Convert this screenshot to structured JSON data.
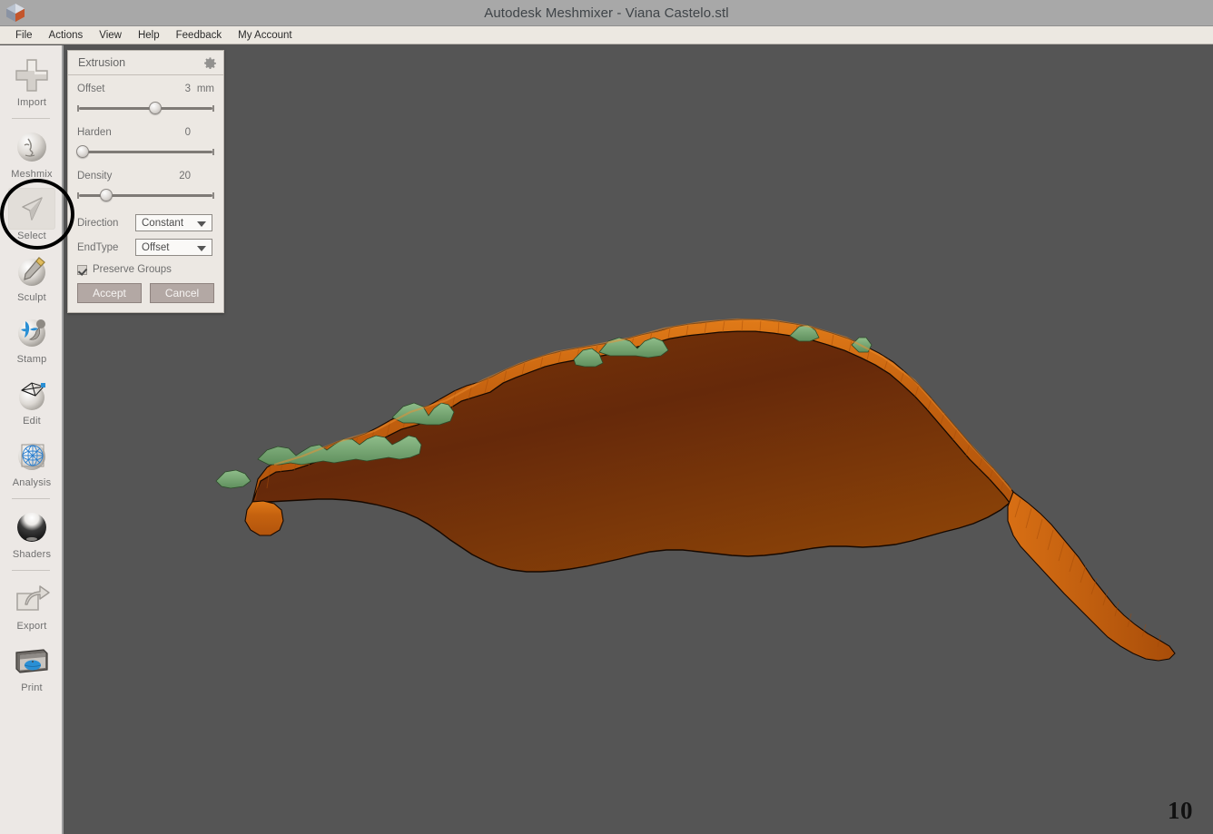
{
  "window": {
    "title": "Autodesk Meshmixer - Viana Castelo.stl",
    "logo_icon": "meshmixer-cube-logo"
  },
  "menubar": {
    "items": [
      {
        "label": "File",
        "name": "menu-file"
      },
      {
        "label": "Actions",
        "name": "menu-actions"
      },
      {
        "label": "View",
        "name": "menu-view"
      },
      {
        "label": "Help",
        "name": "menu-help"
      },
      {
        "label": "Feedback",
        "name": "menu-feedback"
      },
      {
        "label": "My Account",
        "name": "menu-my-account"
      }
    ]
  },
  "sidebar": {
    "items": [
      {
        "label": "Import",
        "icon": "plus-icon",
        "selected": false,
        "separator_after": true
      },
      {
        "label": "Meshmix",
        "icon": "face-sphere-icon",
        "selected": false,
        "separator_after": false
      },
      {
        "label": "Select",
        "icon": "cursor-arrow-icon",
        "selected": true,
        "separator_after": false
      },
      {
        "label": "Sculpt",
        "icon": "brush-sphere-icon",
        "selected": false,
        "separator_after": false
      },
      {
        "label": "Stamp",
        "icon": "stamp-sphere-icon",
        "selected": false,
        "separator_after": false
      },
      {
        "label": "Edit",
        "icon": "mesh-plane-sphere-icon",
        "selected": false,
        "separator_after": false
      },
      {
        "label": "Analysis",
        "icon": "wireframe-sphere-icon",
        "selected": false,
        "separator_after": true
      },
      {
        "label": "Shaders",
        "icon": "shaded-sphere-icon",
        "selected": false,
        "separator_after": true
      },
      {
        "label": "Export",
        "icon": "export-arrow-icon",
        "selected": false,
        "separator_after": false
      },
      {
        "label": "Print",
        "icon": "printer-icon",
        "selected": false,
        "separator_after": false
      }
    ],
    "annotation": "black-circle-highlight-on-select"
  },
  "extrusion_panel": {
    "title": "Extrusion",
    "gear_icon": "gear-icon",
    "offset": {
      "label": "Offset",
      "value": "3",
      "unit": "mm",
      "slider_percent": 57
    },
    "harden": {
      "label": "Harden",
      "value": "0",
      "slider_percent": 3
    },
    "density": {
      "label": "Density",
      "value": "20",
      "slider_percent": 20
    },
    "direction": {
      "label": "Direction",
      "value": "Constant"
    },
    "endtype": {
      "label": "EndType",
      "value": "Offset"
    },
    "preserve_groups": {
      "label": "Preserve Groups",
      "checked": true
    },
    "accept_label": "Accept",
    "cancel_label": "Cancel"
  },
  "viewport": {
    "background_color": "#555555",
    "frame_counter": "10",
    "model": {
      "name": "Viana Castelo terrain extrusion",
      "top_surface_color": "#6b2f06",
      "extruded_wall_color": "#cb6a14",
      "terrain_green_color": "#7ba878",
      "outline_color": "#1a0c02"
    }
  },
  "colors": {
    "titlebar": "#a8a8a8",
    "menubar": "#ece8e1",
    "sidebar": "#ece8e5",
    "panel": "#ece8e3",
    "button": "#b3a8a4",
    "viewport": "#555555"
  }
}
